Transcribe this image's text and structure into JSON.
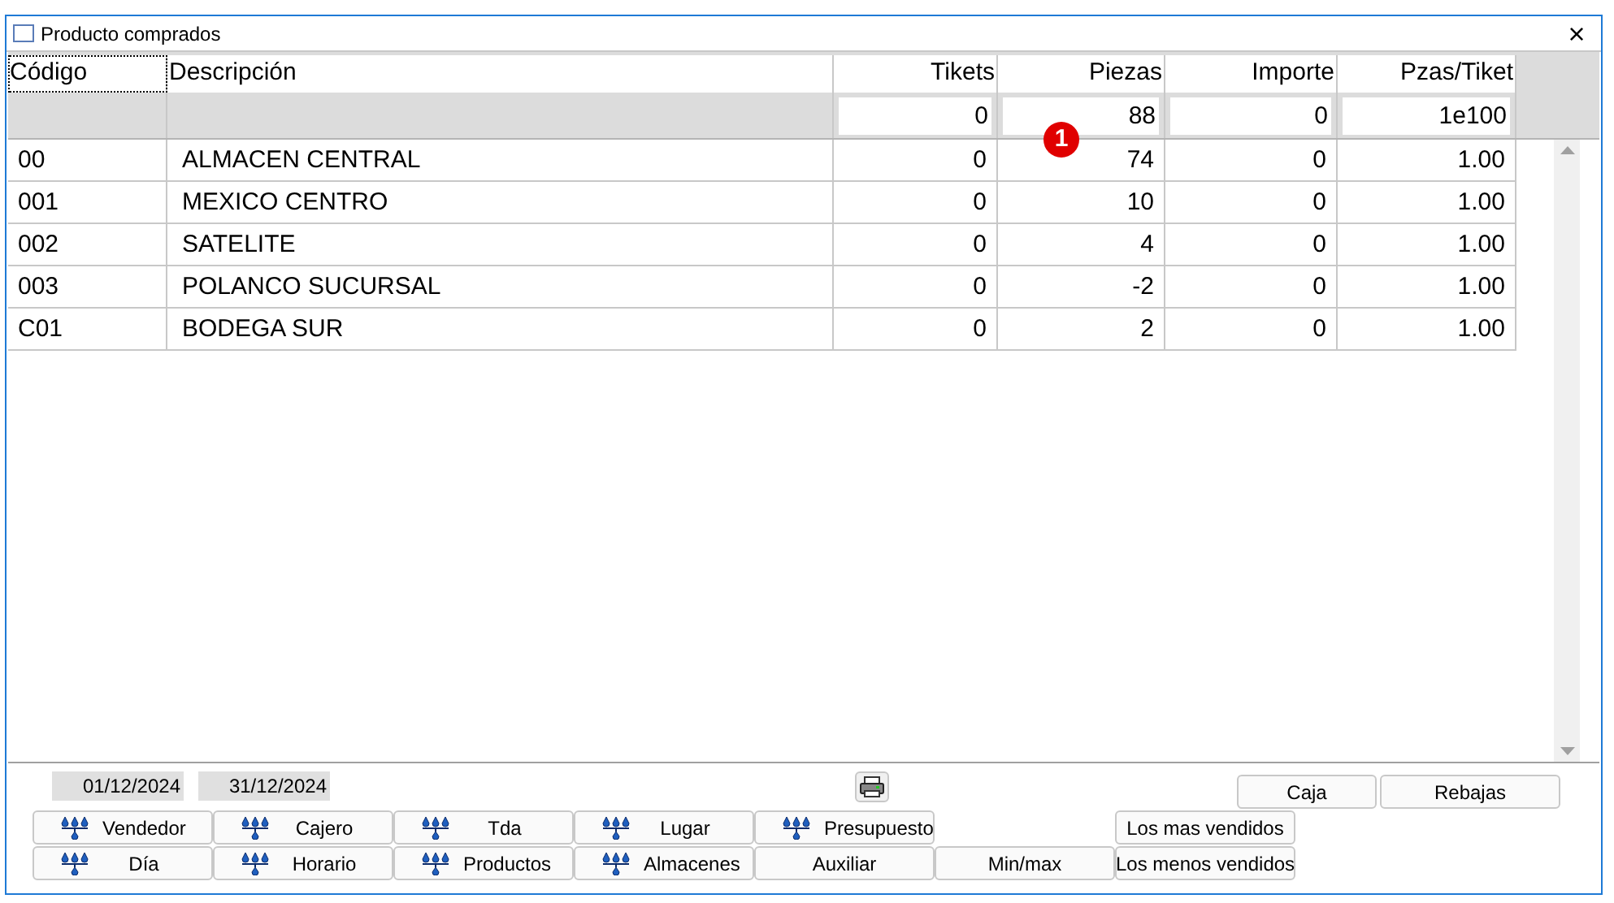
{
  "window": {
    "title": "Producto comprados",
    "close": "×"
  },
  "table": {
    "columns": [
      "Código",
      "Descripción",
      "Tikets",
      "Piezas",
      "Importe",
      "Pzas/Tiket"
    ],
    "totals": [
      "0",
      "88",
      "0",
      "1e100"
    ],
    "rows": [
      {
        "cells": [
          "00",
          "ALMACEN CENTRAL",
          "0",
          "74",
          "0",
          "1.00"
        ]
      },
      {
        "cells": [
          "001",
          "MEXICO CENTRO",
          "0",
          "10",
          "0",
          "1.00"
        ]
      },
      {
        "cells": [
          "002",
          "SATELITE",
          "0",
          "4",
          "0",
          "1.00"
        ]
      },
      {
        "cells": [
          "003",
          "POLANCO SUCURSAL",
          "0",
          "-2",
          "0",
          "1.00"
        ]
      },
      {
        "cells": [
          "C01",
          "BODEGA SUR",
          "0",
          "2",
          "0",
          "1.00"
        ]
      }
    ]
  },
  "marker": "1",
  "dates": [
    "01/12/2024",
    "31/12/2024"
  ],
  "right_buttons": [
    "Caja",
    "Rebajas"
  ],
  "button_rows": [
    [
      {
        "label": "Vendedor",
        "kind": "grouped"
      },
      {
        "label": "Cajero",
        "kind": "grouped"
      },
      {
        "label": "Tda",
        "kind": "grouped"
      },
      {
        "label": "Lugar",
        "kind": "grouped"
      },
      {
        "label": "Presupuesto",
        "kind": "grouped"
      },
      {
        "label": "Los mas vendidos",
        "kind": "plain"
      }
    ],
    [
      {
        "label": "Día",
        "kind": "grouped"
      },
      {
        "label": "Horario",
        "kind": "grouped"
      },
      {
        "label": "Productos",
        "kind": "grouped"
      },
      {
        "label": "Almacenes",
        "kind": "grouped"
      },
      {
        "label": "Auxiliar",
        "kind": "plain"
      },
      {
        "label": "Min/max",
        "kind": "plain"
      },
      {
        "label": "Los menos vendidos",
        "kind": "plain"
      }
    ]
  ]
}
